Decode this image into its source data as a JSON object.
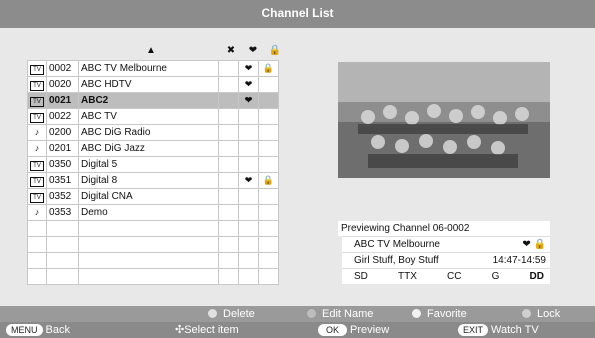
{
  "title": "Channel List",
  "headers": {
    "sort_icon": "▲",
    "delete_icon": "✖",
    "favorite_icon": "❤",
    "lock_icon": "🔒"
  },
  "channels": [
    {
      "type": "tv",
      "type_label": "TV",
      "num": "0002",
      "name": "ABC TV Melbourne",
      "fav": "❤",
      "lock": "🔒"
    },
    {
      "type": "tv",
      "type_label": "TV",
      "num": "0020",
      "name": "ABC HDTV",
      "fav": "❤",
      "lock": ""
    },
    {
      "type": "tv",
      "type_label": "TV",
      "num": "0021",
      "name": "ABC2",
      "fav": "❤",
      "lock": "",
      "selected": true
    },
    {
      "type": "tv",
      "type_label": "TV",
      "num": "0022",
      "name": "ABC TV",
      "fav": "",
      "lock": ""
    },
    {
      "type": "radio",
      "type_label": "♪",
      "num": "0200",
      "name": "ABC DiG Radio",
      "fav": "",
      "lock": ""
    },
    {
      "type": "radio",
      "type_label": "♪",
      "num": "0201",
      "name": "ABC DiG Jazz",
      "fav": "",
      "lock": ""
    },
    {
      "type": "tv",
      "type_label": "TV",
      "num": "0350",
      "name": "Digital 5",
      "fav": "",
      "lock": ""
    },
    {
      "type": "tv",
      "type_label": "TV",
      "num": "0351",
      "name": "Digital 8",
      "fav": "❤",
      "lock": "🔒"
    },
    {
      "type": "tv",
      "type_label": "TV",
      "num": "0352",
      "name": "Digital CNA",
      "fav": "",
      "lock": ""
    },
    {
      "type": "radio",
      "type_label": "♪",
      "num": "0353",
      "name": "Demo",
      "fav": "",
      "lock": ""
    }
  ],
  "empty_rows": 4,
  "preview": {
    "heading": "Previewing Channel 06-0002",
    "channel_name": "ABC TV Melbourne",
    "channel_icons": "❤ 🔒",
    "program": "Girl Stuff, Boy Stuff",
    "time": "14:47-14:59",
    "tags": [
      "SD",
      "TTX",
      "CC",
      "G",
      "DD"
    ]
  },
  "legend": {
    "delete": "Delete",
    "edit_name": "Edit Name",
    "favorite": "Favorite",
    "lock": "Lock"
  },
  "nav": {
    "menu_key": "MENU",
    "back": "Back",
    "select": "Select item",
    "ok_key": "OK",
    "preview": "Preview",
    "exit_key": "EXIT",
    "watch": "Watch TV"
  }
}
